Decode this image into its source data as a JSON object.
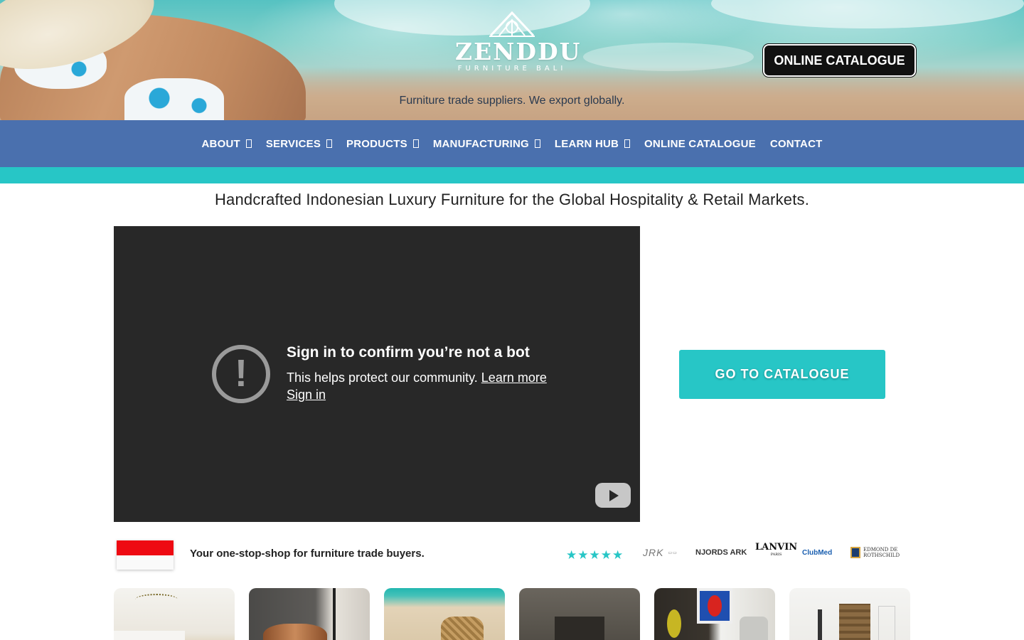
{
  "header": {
    "logo_name": "ZENDDU",
    "logo_sub": "FURNITURE BALI",
    "tagline": "Furniture trade suppliers. We export globally.",
    "catalogue_button": "ONLINE CATALOGUE"
  },
  "nav": {
    "items": [
      {
        "label": "ABOUT",
        "has_dropdown": true
      },
      {
        "label": "SERVICES",
        "has_dropdown": true
      },
      {
        "label": "PRODUCTS",
        "has_dropdown": true
      },
      {
        "label": "MANUFACTURING",
        "has_dropdown": true
      },
      {
        "label": "LEARN HUB",
        "has_dropdown": true
      },
      {
        "label": "ONLINE CATALOGUE",
        "has_dropdown": false
      },
      {
        "label": "CONTACT",
        "has_dropdown": false
      }
    ]
  },
  "main": {
    "headline": "Handcrafted Indonesian Luxury Furniture for the Global Hospitality & Retail Markets.",
    "video": {
      "title": "Sign in to confirm you’re not a bot",
      "body": "This helps protect our community.",
      "learn_more": "Learn more",
      "sign_in": "Sign in"
    },
    "goto_button": "GO TO CATALOGUE"
  },
  "trust": {
    "one_stop": "Your one-stop-shop for furniture trade buyers.",
    "stars": "★★★★★",
    "brands": {
      "jrk": "JRK",
      "njords": "NJORDS ARK",
      "lanvin": "LANVIN",
      "lanvin_sub": "PARIS",
      "clubmed": "ClubMed",
      "rothschild": "EDMOND DE ROTHSCHILD"
    }
  },
  "colors": {
    "nav_bg": "#4a70ae",
    "accent_teal": "#27c6c6",
    "video_bg": "#282828"
  }
}
